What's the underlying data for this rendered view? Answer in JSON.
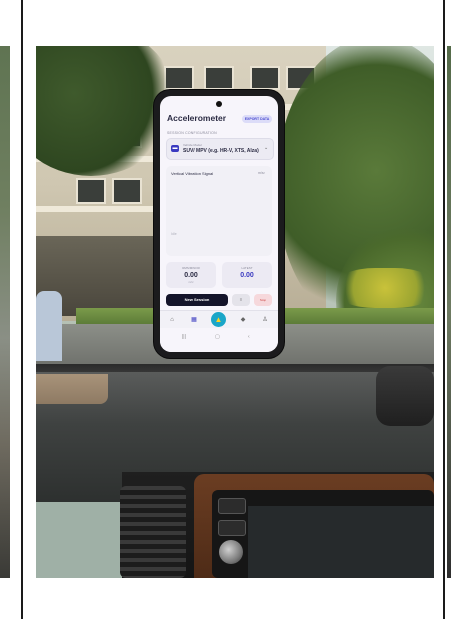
{
  "phone_app": {
    "title": "Accelerometer",
    "export_label": "EXPORT DATA",
    "section_label": "SESSION CONFIGURATION",
    "vehicle": {
      "sub_label": "Vehicle Model",
      "value": "SUV/ MPV (e.g. HR-V, XTS, Alza)"
    },
    "signal": {
      "title": "Vertical Vibration Signal",
      "unit": "m/s²",
      "empty_text": "Idle"
    },
    "stats": [
      {
        "label": "RMS/MINOR",
        "value": "0.00",
        "unit": "m/s²"
      },
      {
        "label": "LATEST",
        "value": "0.00",
        "unit": ""
      }
    ],
    "actions": {
      "new_session": "New Session",
      "mini_a": "≡",
      "mini_b": "Stop"
    },
    "nav": {
      "icons": [
        "home-icon",
        "chart-icon",
        "warning-icon",
        "map-icon",
        "person-icon"
      ]
    }
  },
  "icons": {
    "vehicle": "car-icon",
    "chevron": "chevron-down-icon"
  }
}
